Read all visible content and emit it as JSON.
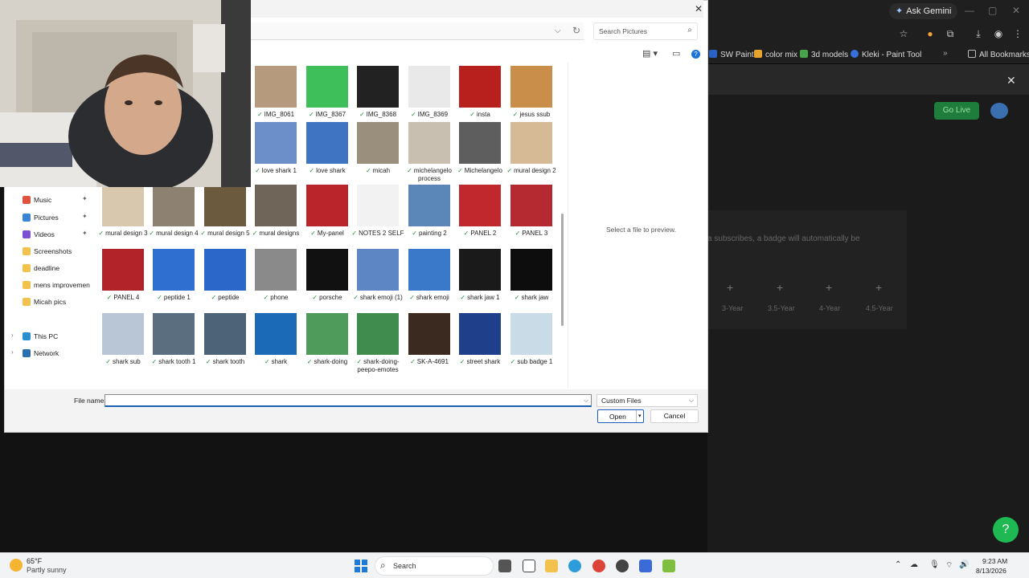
{
  "browser": {
    "ask_gemini": "Ask Gemini",
    "bookmarks": [
      "SW Paint",
      "color mix",
      "3d models",
      "Kleki - Paint Tool"
    ],
    "all_bookmarks": "All Bookmarks",
    "go_live": "Go Live",
    "panel_note": "a subscribes, a badge will automatically be",
    "badge_labels": [
      "3-Year",
      "3.5-Year",
      "4-Year",
      "4.5-Year"
    ]
  },
  "dialog": {
    "search_placeholder": "Search Pictures",
    "preview_text": "Select a file to preview.",
    "file_name_label": "File name:",
    "file_name_value": "",
    "file_type": "Custom Files",
    "open_label": "Open",
    "cancel_label": "Cancel"
  },
  "nav": {
    "items": [
      {
        "label": "Music",
        "icon": "music-icon",
        "color": "#e0533d",
        "pinned": true
      },
      {
        "label": "Pictures",
        "icon": "pictures-icon",
        "color": "#3b86d4",
        "pinned": true
      },
      {
        "label": "Videos",
        "icon": "videos-icon",
        "color": "#7a4fd1",
        "pinned": true
      },
      {
        "label": "Screenshots",
        "icon": "folder-icon",
        "color": "#f2c14e",
        "pinned": false
      },
      {
        "label": "deadline",
        "icon": "folder-icon",
        "color": "#f2c14e",
        "pinned": false
      },
      {
        "label": "mens improvemen",
        "icon": "folder-icon",
        "color": "#f2c14e",
        "pinned": false
      },
      {
        "label": "Micah pics",
        "icon": "folder-icon",
        "color": "#f2c14e",
        "pinned": false
      },
      {
        "label": "This PC",
        "icon": "computer-icon",
        "color": "#2a8fcf",
        "pinned": false,
        "expandable": true
      },
      {
        "label": "Network",
        "icon": "network-icon",
        "color": "#2a6fb0",
        "pinned": false,
        "expandable": true
      }
    ]
  },
  "files": [
    {
      "name": "IMG_8061",
      "color": "#b59a7e"
    },
    {
      "name": "IMG_8367",
      "color": "#3fbf5a"
    },
    {
      "name": "IMG_8368",
      "color": "#222222"
    },
    {
      "name": "IMG_8369",
      "color": "#e9e9e9"
    },
    {
      "name": "insta",
      "color": "#b8201d"
    },
    {
      "name": "jesus ssub",
      "color": "#c98f4a"
    },
    {
      "name": "love shark 1",
      "color": "#6c8ec9"
    },
    {
      "name": "love shark",
      "color": "#3f74c2"
    },
    {
      "name": "micah",
      "color": "#9a8e7c"
    },
    {
      "name": "michelangelo process",
      "color": "#c9bfb1"
    },
    {
      "name": "Michelangelo",
      "color": "#5e5e5e"
    },
    {
      "name": "mural design 2",
      "color": "#d6b995"
    },
    {
      "name": "mural design 3",
      "color": "#d8c8ae"
    },
    {
      "name": "mural design 4",
      "color": "#8d8272"
    },
    {
      "name": "mural design 5",
      "color": "#6b5a3d"
    },
    {
      "name": "mural designs",
      "color": "#6f6659"
    },
    {
      "name": "My-panel",
      "color": "#b9252a"
    },
    {
      "name": "NOTES 2 SELF",
      "color": "#f2f2f2"
    },
    {
      "name": "painting 2",
      "color": "#5b87b8"
    },
    {
      "name": "PANEL 2",
      "color": "#c0282d"
    },
    {
      "name": "PANEL 3",
      "color": "#b42a30"
    },
    {
      "name": "PANEL 4",
      "color": "#b12328"
    },
    {
      "name": "peptide 1",
      "color": "#2f6fd0"
    },
    {
      "name": "peptide",
      "color": "#2a67c9"
    },
    {
      "name": "phone",
      "color": "#8a8a8a"
    },
    {
      "name": "porsche",
      "color": "#111111"
    },
    {
      "name": "shark emoji (1)",
      "color": "#5d86c4"
    },
    {
      "name": "shark emoji",
      "color": "#3a78c9"
    },
    {
      "name": "shark jaw 1",
      "color": "#1a1a1a"
    },
    {
      "name": "shark jaw",
      "color": "#0d0d0d"
    },
    {
      "name": "shark sub",
      "color": "#b8c6d6"
    },
    {
      "name": "shark tooth 1",
      "color": "#5a6e80"
    },
    {
      "name": "shark tooth",
      "color": "#4d6478"
    },
    {
      "name": "shark",
      "color": "#1a6ab8"
    },
    {
      "name": "shark-doing",
      "color": "#4e9b5c"
    },
    {
      "name": "shark-doing-peepo-emotes",
      "color": "#3f8c4e"
    },
    {
      "name": "SK-A-4691",
      "color": "#3a2a1f"
    },
    {
      "name": "street shark",
      "color": "#1f3f8a"
    },
    {
      "name": "sub badge 1",
      "color": "#c9dbe6"
    }
  ],
  "taskbar": {
    "temperature": "65°F",
    "weather": "Partly sunny",
    "search_label": "Search",
    "time": "9:23 AM",
    "date": "8/13/2026"
  }
}
